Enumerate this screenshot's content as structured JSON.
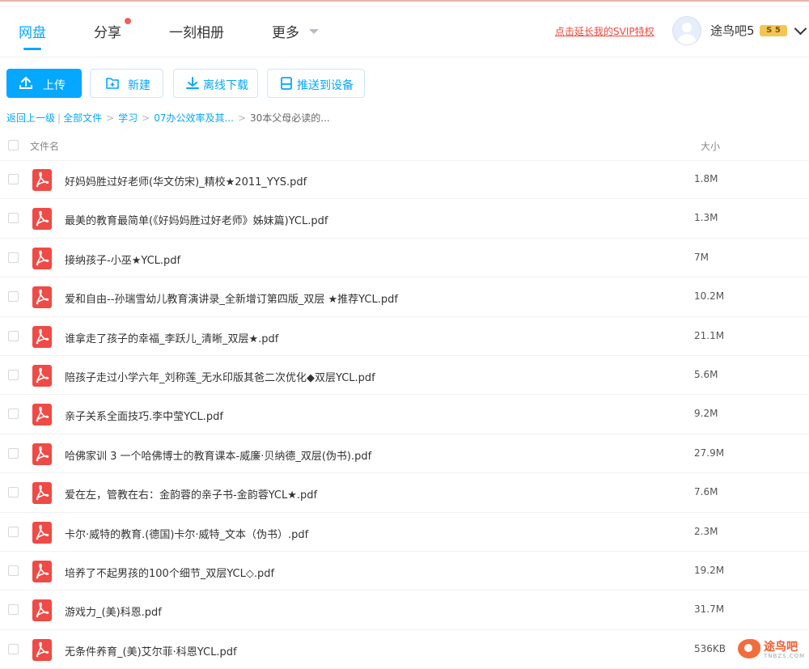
{
  "nav": {
    "tabs": [
      {
        "label": "网盘"
      },
      {
        "label": "分享"
      },
      {
        "label": "一刻相册"
      },
      {
        "label": "更多"
      }
    ],
    "svip_link": "点击延长我的SVIP特权",
    "username": "途鸟吧5",
    "vip_badge": "S 5"
  },
  "toolbar": {
    "upload": "上传",
    "new": "新建",
    "offline_download": "离线下载",
    "push_to_device": "推送到设备"
  },
  "breadcrumb": {
    "back": "返回上一级",
    "items": [
      "全部文件",
      "学习",
      "07办公效率及其..."
    ],
    "current": "30本父母必读的..."
  },
  "table": {
    "col_name": "文件名",
    "col_size": "大小",
    "rows": [
      {
        "name": "好妈妈胜过好老师(华文仿宋)_精校★2011_YYS.pdf",
        "size": "1.8M"
      },
      {
        "name": "最美的教育最简单(《好妈妈胜过好老师》姊妹篇)YCL.pdf",
        "size": "1.3M"
      },
      {
        "name": "接纳孩子-小巫★YCL.pdf",
        "size": "7M"
      },
      {
        "name": "爱和自由--孙瑞雪幼儿教育演讲录_全新增订第四版_双层 ★推荐YCL.pdf",
        "size": "10.2M"
      },
      {
        "name": "谁拿走了孩子的幸福_李跃儿_清晰_双层★.pdf",
        "size": "21.1M"
      },
      {
        "name": "陪孩子走过小学六年_刘称莲_无水印版其爸二次优化◆双层YCL.pdf",
        "size": "5.6M"
      },
      {
        "name": "亲子关系全面技巧.李中莹YCL.pdf",
        "size": "9.2M"
      },
      {
        "name": "哈佛家训 3 一个哈佛博士的教育课本-威廉·贝纳德_双层(伪书).pdf",
        "size": "27.9M"
      },
      {
        "name": "爱在左，管教在右：金韵蓉的亲子书-金韵蓉YCL★.pdf",
        "size": "7.6M"
      },
      {
        "name": "卡尔·威特的教育.(德国)卡尔·威特_文本（伪书）.pdf",
        "size": "2.3M"
      },
      {
        "name": "培养了不起男孩的100个细节_双层YCL◇.pdf",
        "size": "19.2M"
      },
      {
        "name": "游戏力_(美)科恩.pdf",
        "size": "31.7M"
      },
      {
        "name": "无条件养育_(美)艾尔菲·科恩YCL.pdf",
        "size": "536KB"
      }
    ]
  },
  "watermark": {
    "name": "途鸟吧",
    "domain": "TNBZS.COM"
  },
  "colors": {
    "accent": "#06a7ff",
    "pdf_red": "#ef4a46",
    "svip_red": "#f04a3c"
  }
}
